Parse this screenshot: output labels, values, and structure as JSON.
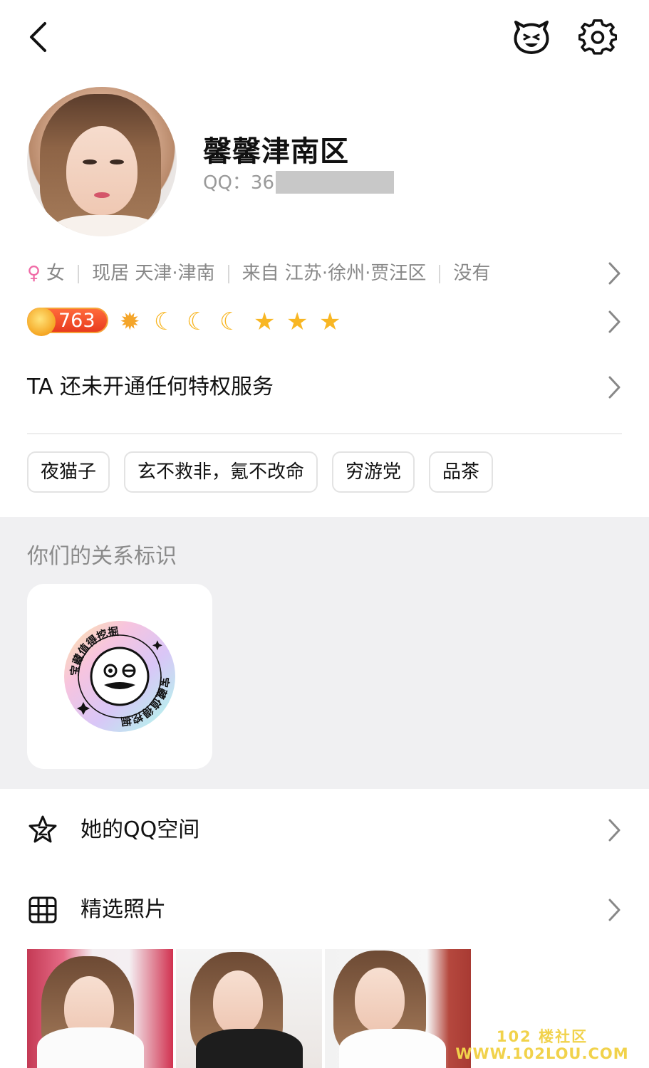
{
  "header": {
    "back_icon": "chevron-left-icon",
    "pet_icon": "pet-face-icon",
    "settings_icon": "gear-icon"
  },
  "profile": {
    "nickname": "馨馨津南区",
    "qq_label": "QQ：36"
  },
  "info": {
    "gender": "女",
    "current": "现居 天津·津南",
    "hometown": "来自 江苏·徐州·贾汪区",
    "extra": "没有"
  },
  "level": {
    "value": "763",
    "icons": [
      "sun",
      "moon",
      "moon",
      "moon",
      "star",
      "star",
      "star"
    ]
  },
  "privilege": {
    "text": "TA 还未开通任何特权服务"
  },
  "tags": [
    "夜猫子",
    "玄不救非，氪不改命",
    "穷游党",
    "品茶"
  ],
  "relation": {
    "title": "你们的关系标识",
    "badge_text": "宝藏值得挖掘"
  },
  "menu": {
    "qzone": "她的QQ空间",
    "photos": "精选照片"
  },
  "watermark": {
    "line1": "102 楼社区",
    "line2": "WWW.102LOU.COM"
  },
  "colors": {
    "accent_female": "#f06aa6",
    "level_badge": "#e83b1f",
    "level_icons": "#f8b623",
    "watermark": "#f1d24b"
  }
}
